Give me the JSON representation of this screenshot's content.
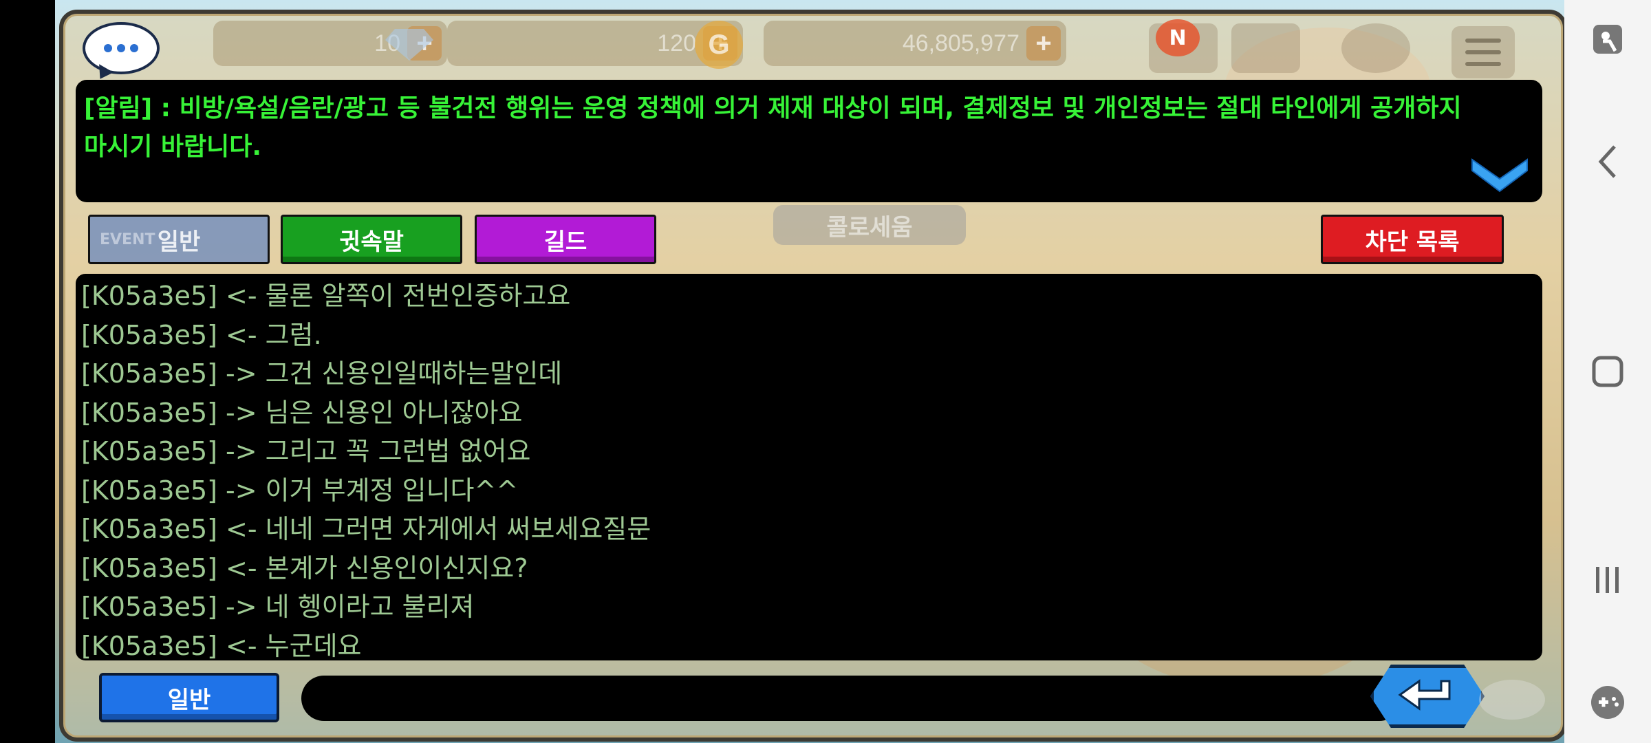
{
  "status_bar": {
    "stamina": "10",
    "gems": "120",
    "gold": "46,805,977",
    "coin_symbol": "G",
    "notification_badge": "N"
  },
  "notice": {
    "text": "[알림] : 비방/욕설/음란/광고 등 불건전 행위는 운영 정책에 의거 제재 대상이 되며, 결제정보 및 개인정보는 절대 타인에게 공개하지 마시기 바랍니다."
  },
  "channels": {
    "general": "일반",
    "whisper": "귓속말",
    "guild": "길드",
    "block_list": "차단 목록"
  },
  "background_labels": {
    "colosseum": "콜로세움",
    "event": "EVENT"
  },
  "chat_log": [
    "[K05a3e5] <- 물론 알쪽이 전번인증하고요",
    "[K05a3e5] <- 그럼.",
    "[K05a3e5] -> 그건 신용인일때하는말인데",
    "[K05a3e5] -> 님은 신용인 아니잖아요",
    "[K05a3e5] -> 그리고 꼭 그런법 없어요",
    "[K05a3e5] -> 이거 부계정 입니다^^",
    "[K05a3e5] <- 네네 그러면 자게에서 써보세요질문",
    "[K05a3e5] <- 본계가 신용인이신지요?",
    "[K05a3e5] -> 네 헹이라고 불리져",
    "[K05a3e5] <- 누군데요"
  ],
  "input": {
    "channel_label": "일반",
    "value": "",
    "placeholder": ""
  },
  "colors": {
    "notice_text": "#37f337",
    "chat_text": "#9ec993",
    "whisper": "#18a020",
    "guild": "#b21bd6",
    "block": "#de1c22",
    "general": "#1f73e8"
  },
  "icons": {
    "chat": "chat-bubble-icon",
    "mail": "mail-icon",
    "shop": "shop-icon",
    "map": "map-pin-icon",
    "menu": "menu-icon",
    "expand": "chevron-down-icon",
    "send": "enter-icon"
  }
}
